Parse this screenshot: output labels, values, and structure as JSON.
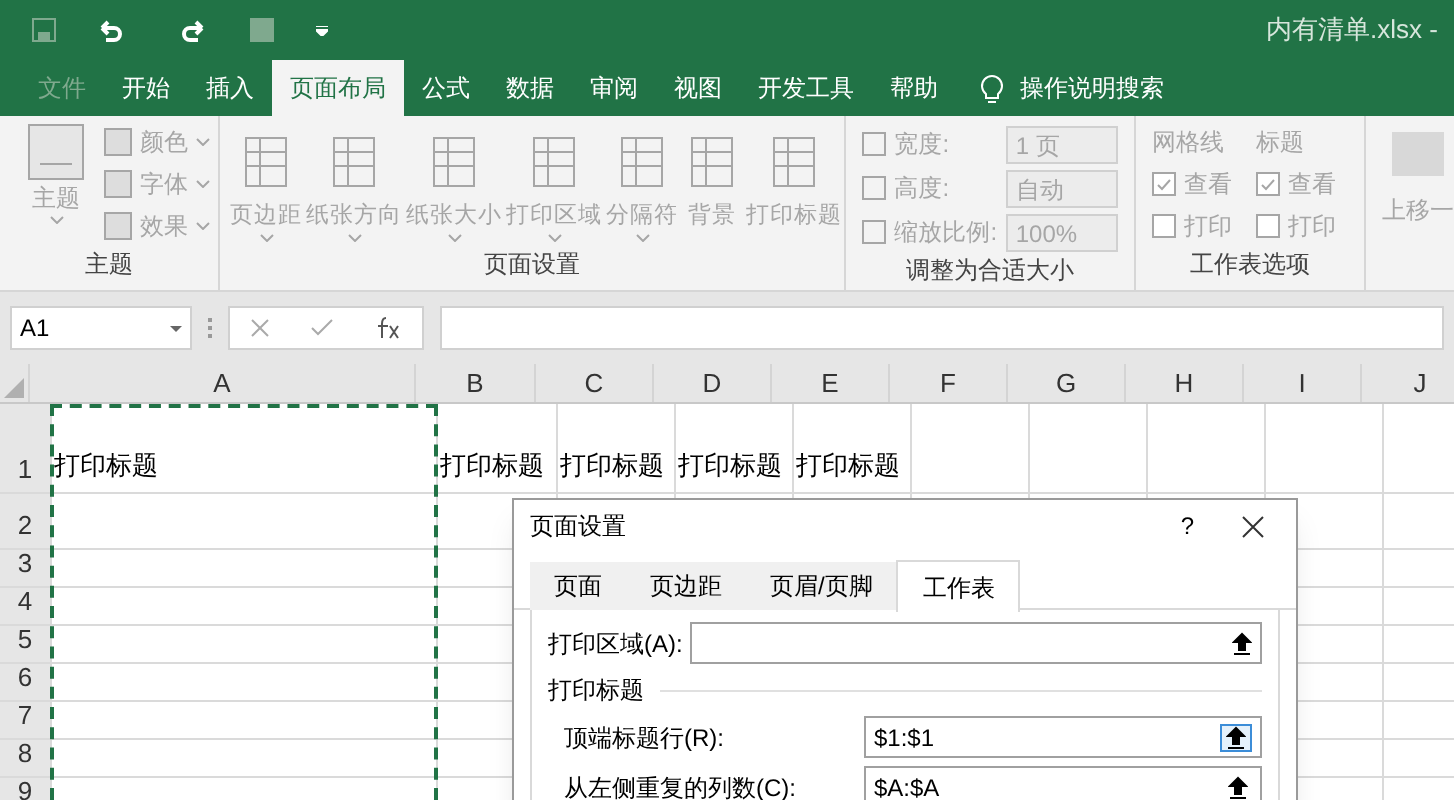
{
  "title_bar": {
    "filename": "内有清单.xlsx -"
  },
  "menu_tabs": [
    {
      "label": "文件",
      "selected": false,
      "kind": "file"
    },
    {
      "label": "开始",
      "selected": false,
      "kind": "tab"
    },
    {
      "label": "插入",
      "selected": false,
      "kind": "tab"
    },
    {
      "label": "页面布局",
      "selected": true,
      "kind": "tab"
    },
    {
      "label": "公式",
      "selected": false,
      "kind": "tab"
    },
    {
      "label": "数据",
      "selected": false,
      "kind": "tab"
    },
    {
      "label": "审阅",
      "selected": false,
      "kind": "tab"
    },
    {
      "label": "视图",
      "selected": false,
      "kind": "tab"
    },
    {
      "label": "开发工具",
      "selected": false,
      "kind": "tab"
    },
    {
      "label": "帮助",
      "selected": false,
      "kind": "tab"
    },
    {
      "label": "操作说明搜索",
      "selected": false,
      "kind": "search"
    }
  ],
  "ribbon": {
    "disabled": true,
    "theme": {
      "label": "主题",
      "big": "主题",
      "items": [
        "颜色",
        "字体",
        "效果"
      ]
    },
    "page_setup": {
      "label": "页面设置",
      "items": [
        "页边距",
        "纸张方向",
        "纸张大小",
        "打印区域",
        "分隔符",
        "背景",
        "打印标题"
      ]
    },
    "scale": {
      "label": "调整为合适大小",
      "rows": [
        {
          "label": "宽度:",
          "value": "1 页"
        },
        {
          "label": "高度:",
          "value": "自动"
        },
        {
          "label": "缩放比例:",
          "value": "100%"
        }
      ]
    },
    "sheet_options": {
      "label": "工作表选项",
      "columns": [
        {
          "heading": "网格线",
          "options": [
            {
              "label": "查看",
              "checked": true
            },
            {
              "label": "打印",
              "checked": false
            }
          ]
        },
        {
          "heading": "标题",
          "options": [
            {
              "label": "查看",
              "checked": true
            },
            {
              "label": "打印",
              "checked": false
            }
          ]
        }
      ]
    },
    "arrange": {
      "item": "上移一"
    }
  },
  "formula_bar": {
    "name_box": "A1"
  },
  "sheet": {
    "columns": [
      "A",
      "B",
      "C",
      "D",
      "E",
      "F",
      "G",
      "H",
      "I",
      "J"
    ],
    "rows": [
      {
        "number": "1",
        "cells": [
          "打印标题",
          "打印标题",
          "打印标题",
          "打印标题",
          "打印标题"
        ]
      },
      {
        "number": "2",
        "cells": []
      },
      {
        "number": "3",
        "cells": []
      },
      {
        "number": "4",
        "cells": []
      },
      {
        "number": "5",
        "cells": []
      },
      {
        "number": "6",
        "cells": []
      },
      {
        "number": "7",
        "cells": []
      },
      {
        "number": "8",
        "cells": []
      },
      {
        "number": "9",
        "cells": []
      }
    ]
  },
  "dialog": {
    "title": "页面设置",
    "help": "?",
    "tabs": [
      {
        "label": "页面",
        "selected": false
      },
      {
        "label": "页边距",
        "selected": false
      },
      {
        "label": "页眉/页脚",
        "selected": false
      },
      {
        "label": "工作表",
        "selected": true
      }
    ],
    "print_area": {
      "label": "打印区域(A):"
    },
    "section": "打印标题",
    "fields": [
      {
        "label": "顶端标题行(R):",
        "value": "$1:$1",
        "focused": true
      },
      {
        "label": "从左侧重复的列数(C):",
        "value": "$A:$A",
        "focused": false
      }
    ]
  }
}
